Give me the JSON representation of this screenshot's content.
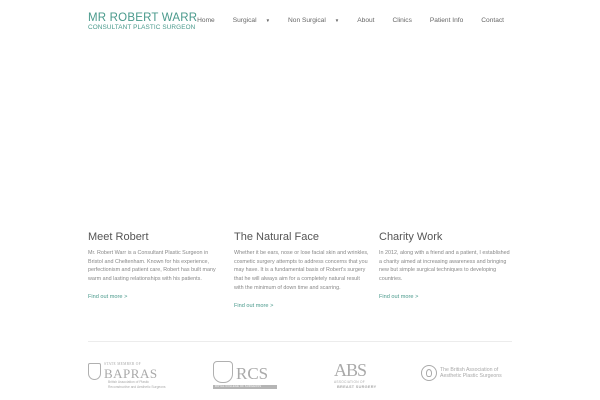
{
  "logo": {
    "name": "MR ROBERT WARR",
    "subtitle": "CONSULTANT PLASTIC SURGEON"
  },
  "nav": {
    "items": [
      {
        "label": "Home",
        "has_dropdown": false
      },
      {
        "label": "Surgical",
        "has_dropdown": true
      },
      {
        "label": "Non Surgical",
        "has_dropdown": true
      },
      {
        "label": "About",
        "has_dropdown": false
      },
      {
        "label": "Clinics",
        "has_dropdown": false
      },
      {
        "label": "Patient Info",
        "has_dropdown": false
      },
      {
        "label": "Contact",
        "has_dropdown": false
      }
    ],
    "caret": "▼"
  },
  "columns": [
    {
      "title": "Meet Robert",
      "body": "Mr. Robert Warr is a Consultant Plastic Surgeon in Bristol and Cheltenham. Known for his experience, perfectionism and patient care, Robert has built many warm and lasting relationships with his patients.",
      "link": "Find out more >"
    },
    {
      "title": "The Natural Face",
      "body": "Whether it be ears, nose or lose facial skin and wrinkles, cosmetic surgery attempts to address concerns that you may have. It is a fundamental basis of Robert's surgery that he will always aim for a completely natural result with the minimum of down time and scarring.",
      "link": "Find out more >"
    },
    {
      "title": "Charity Work",
      "body": "In 2012, along with a friend and a patient, I established a charity aimed at increasing awareness and bringing new but simple surgical techniques to developing countries.",
      "link": "Find out more >"
    }
  ],
  "partners": {
    "bapras": {
      "top": "STATE MEMBER OF",
      "name": "BAPRAS",
      "line1": "British Association of Plastic",
      "line2": "Reconstructive and Aesthetic Surgeons"
    },
    "rcs": {
      "name": "RCS",
      "bar": "ROYAL COLLEGE OF SURGEONS"
    },
    "abs": {
      "name": "ABS",
      "line1": "ASSOCIATION OF",
      "line2": "BREAST SURGERY"
    },
    "baaps": {
      "line1": "The British Association of",
      "line2": "Aesthetic Plastic Surgeons"
    }
  },
  "colors": {
    "brand": "#4a9a8c",
    "text": "#888888",
    "heading": "#555555"
  }
}
